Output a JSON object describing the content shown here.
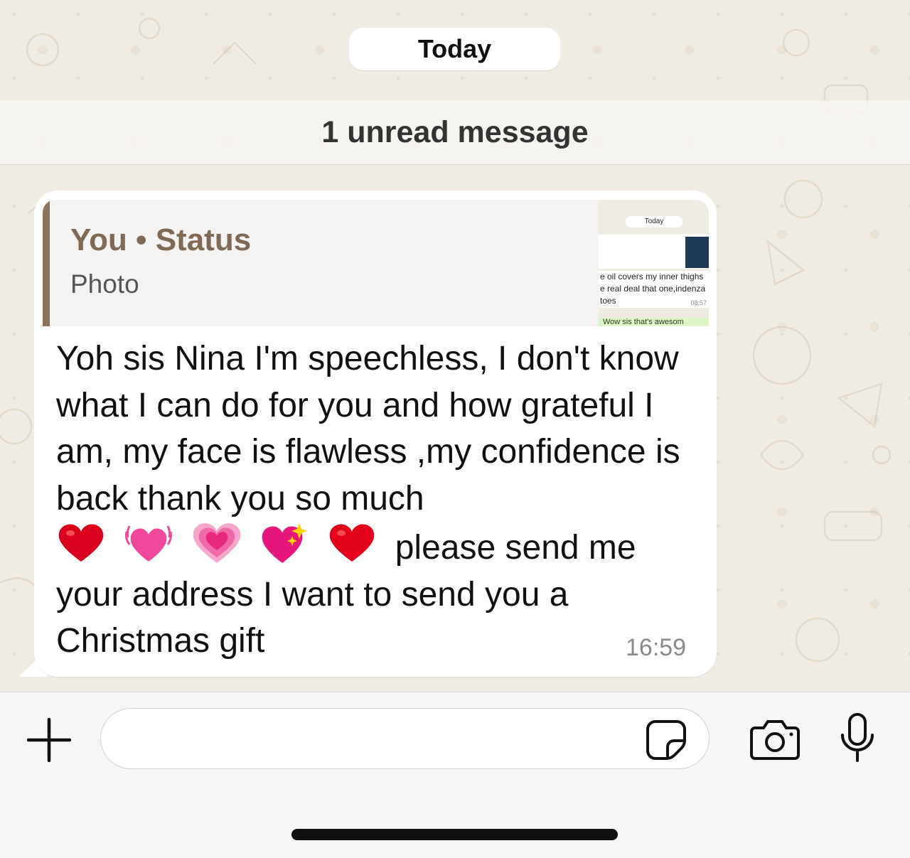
{
  "chat": {
    "date_label": "Today",
    "unread_banner": "1 unread message"
  },
  "message": {
    "quote": {
      "author": "You • Status",
      "type": "Photo",
      "thumbnail": {
        "date_label": "Today",
        "line1": "e oil covers my inner thighs",
        "line2": "e real deal that one,indenza",
        "line3": "toes",
        "time": "08:57",
        "reply_preview": "Wow sis that's awesom"
      }
    },
    "text_part1": "Yoh sis Nina I'm speechless, I don't know what I can do for you and how grateful I am, my face is flawless ,my confidence is back thank you so much",
    "emojis": [
      "red-heart",
      "beating-heart",
      "growing-heart",
      "sparkling-heart",
      "red-heart"
    ],
    "text_part2": "please send me your address I want to send you a Christmas gift",
    "time": "16:59"
  },
  "composer": {
    "input_value": "",
    "icons": [
      "plus-icon",
      "sticker-icon",
      "camera-icon",
      "microphone-icon"
    ]
  },
  "colors": {
    "quote_accent": "#8a745e",
    "quote_author": "#806a55",
    "heart_red": "#d9001b",
    "heart_pink": "#f0489a"
  }
}
